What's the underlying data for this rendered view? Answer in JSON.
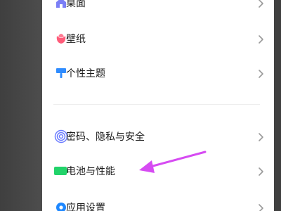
{
  "settings": {
    "items": [
      {
        "label": "桌面",
        "icon": "home-icon",
        "color": "#7b7ff6"
      },
      {
        "label": "壁纸",
        "icon": "tulip-icon",
        "color": "#ff5c7a"
      },
      {
        "label": "个性主题",
        "icon": "brush-icon",
        "color": "#2f8cff"
      },
      {
        "label": "密码、隐私与安全",
        "icon": "fingerprint-icon",
        "color": "#6b7cff"
      },
      {
        "label": "电池与性能",
        "icon": "battery-icon",
        "color": "#22d36a"
      },
      {
        "label": "应用设置",
        "icon": "gear-icon",
        "color": "#1f88ff"
      }
    ]
  },
  "annotation": {
    "icon": "arrow-annotation",
    "color": "#d64bf2"
  }
}
